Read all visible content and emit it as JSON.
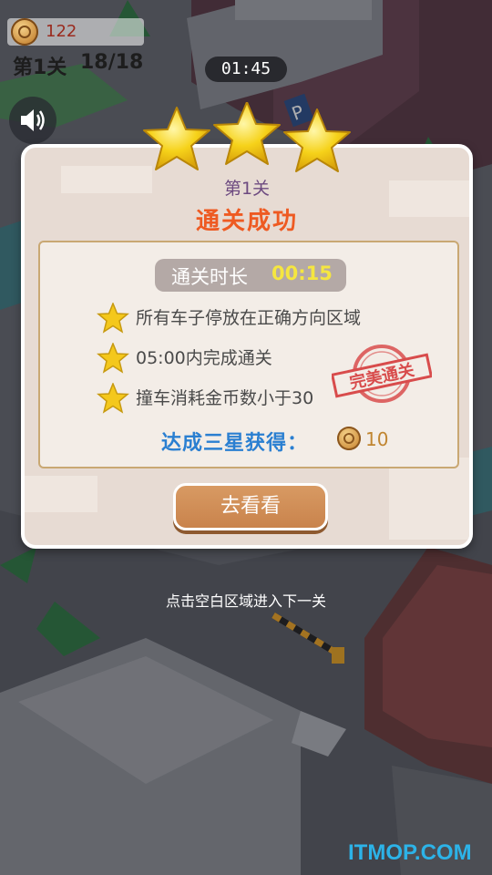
{
  "hud": {
    "coins": "122",
    "level_label": "第1关",
    "level_progress": "18/18",
    "timer": "01:45"
  },
  "dialog": {
    "level": "第1关",
    "title": "通关成功",
    "time_label": "通关时长",
    "time_value": "00:15",
    "conditions": [
      {
        "text": "所有车子停放在正确方向区域",
        "icon": "star-icon"
      },
      {
        "text": "05:00内完成通关",
        "icon": "star-icon"
      },
      {
        "text": "撞车消耗金币数小于30",
        "icon": "star-icon"
      }
    ],
    "stamp_text": "完美通关",
    "reward_label": "达成三星获得：",
    "reward_value": "10",
    "button_label": "去看看"
  },
  "hint": "点击空白区域进入下一关",
  "watermark": "ITMOP.COM",
  "colors": {
    "title_orange": "#ee5a22",
    "reward_blue": "#2a7fd1",
    "time_yellow": "#f5e640",
    "button_brown": "#c9834c",
    "stamp_red": "#d84c4c"
  }
}
